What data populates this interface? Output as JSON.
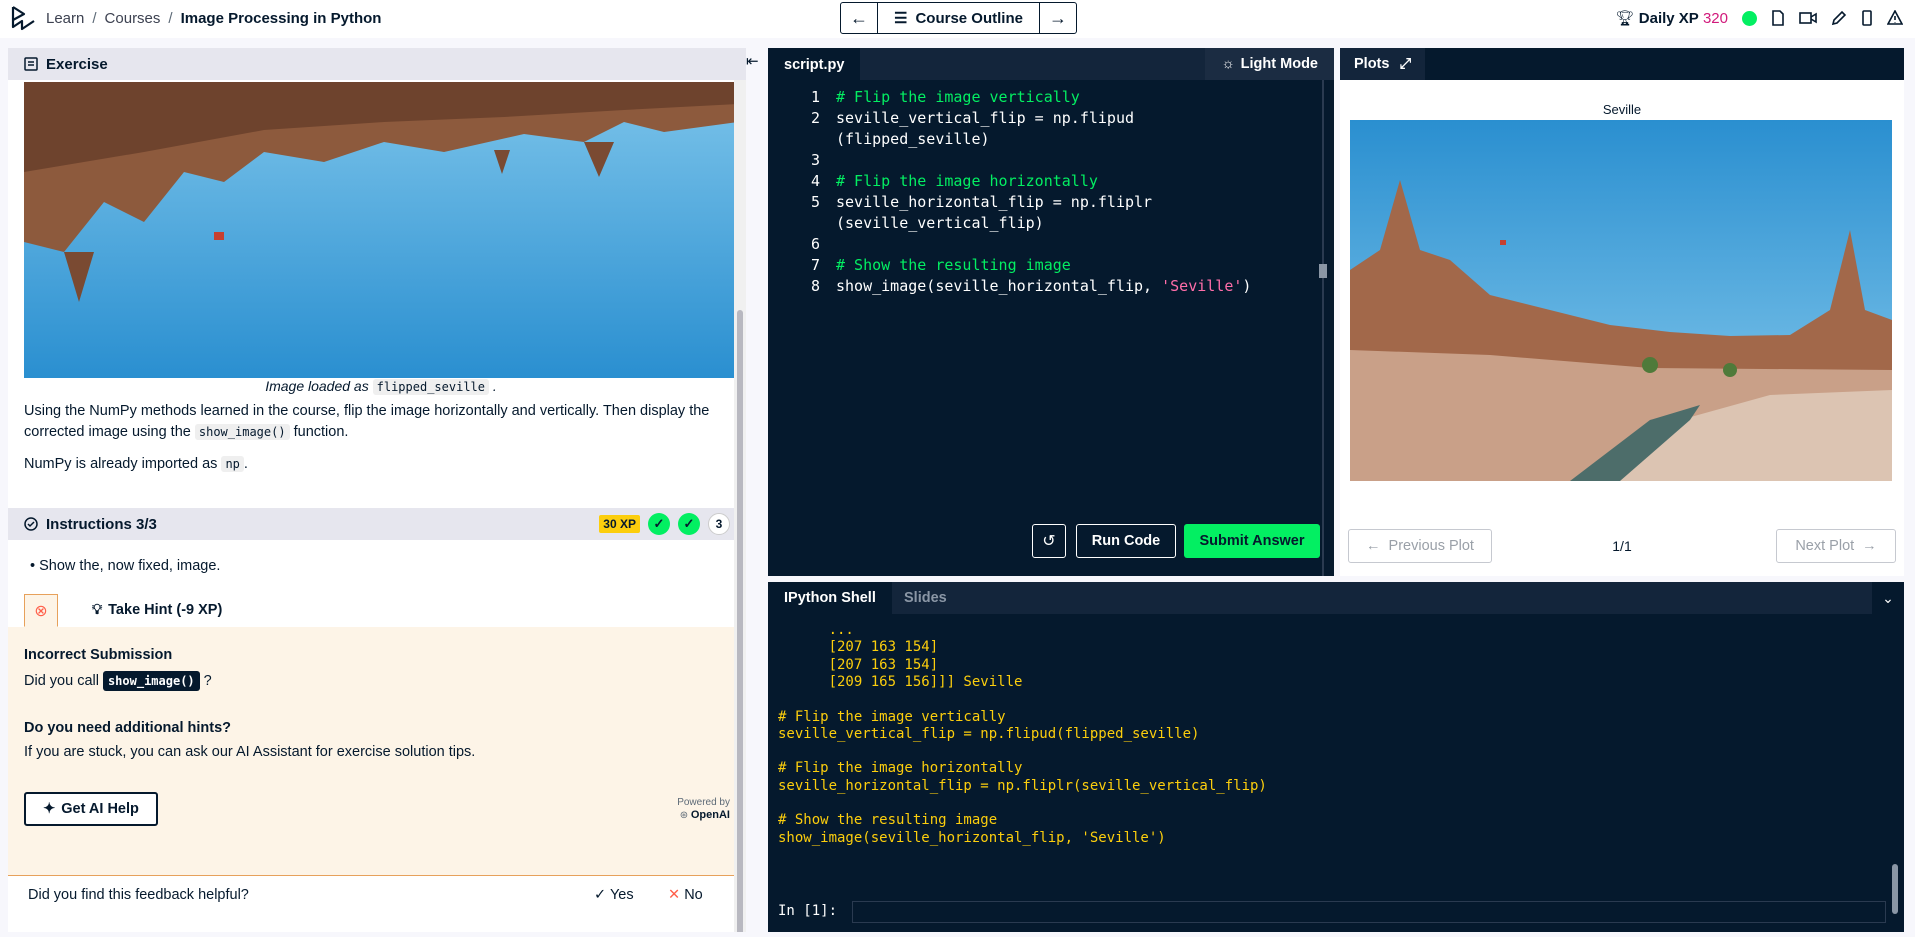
{
  "breadcrumb": {
    "learn": "Learn",
    "courses": "Courses",
    "current": "Image Processing in Python"
  },
  "course_nav": {
    "label": "Course Outline"
  },
  "topbar": {
    "xp_label": "Daily XP",
    "xp_value": "320"
  },
  "exercise": {
    "header": "Exercise",
    "caption_prefix": "Image loaded as",
    "caption_code": "flipped_seville",
    "caption_suffix": ".",
    "para1_a": "Using the NumPy methods learned in the course, flip the image horizontally and vertically. Then display the corrected image using the",
    "para1_code": "show_image()",
    "para1_b": "function.",
    "para2_a": "NumPy is already imported as",
    "para2_code": "np",
    "para2_b": "."
  },
  "instructions": {
    "title": "Instructions 3/3",
    "xp_badge": "30 XP",
    "count": "3",
    "bullet": "Show the, now fixed, image.",
    "hint_tab": "Take Hint (-9 XP)"
  },
  "feedback": {
    "title": "Incorrect Submission",
    "question_a": "Did you call",
    "question_code": "show_image()",
    "question_b": "?",
    "need_hints": "Do you need additional hints?",
    "stuck": "If you are stuck, you can ask our AI Assistant for exercise solution tips.",
    "ai_button": "Get AI Help",
    "powered_by": "Powered by",
    "openai": "OpenAI",
    "helpful": "Did you find this feedback helpful?",
    "yes": "Yes",
    "no": "No"
  },
  "editor": {
    "tab": "script.py",
    "light_mode": "Light Mode",
    "lines": [
      {
        "n": "1",
        "code": "# Flip the image vertically"
      },
      {
        "n": "2",
        "code": "seville_vertical_flip = np.flipud"
      },
      {
        "n": "",
        "code": "(flipped_seville)"
      },
      {
        "n": "3",
        "code": ""
      },
      {
        "n": "4",
        "code": "# Flip the image horizontally"
      },
      {
        "n": "5",
        "code": "seville_horizontal_flip = np.fliplr"
      },
      {
        "n": "",
        "code": "(seville_vertical_flip)"
      },
      {
        "n": "6",
        "code": ""
      },
      {
        "n": "7",
        "code": "# Show the resulting image"
      },
      {
        "n": "8",
        "code": "show_image(seville_horizontal_flip, 'Seville')"
      }
    ],
    "run": "Run Code",
    "submit": "Submit Answer"
  },
  "plots": {
    "tab": "Plots",
    "title": "Seville",
    "prev": "Previous Plot",
    "count": "1/1",
    "next": "Next Plot"
  },
  "shell": {
    "tab": "IPython Shell",
    "slides": "Slides",
    "lines": [
      "      ...",
      "      [207 163 154]",
      "      [207 163 154]",
      "      [209 165 156]]] Seville",
      "",
      "# Flip the image vertically",
      "seville_vertical_flip = np.flipud(flipped_seville)",
      "",
      "# Flip the image horizontally",
      "seville_horizontal_flip = np.fliplr(seville_vertical_flip)",
      "",
      "# Show the resulting image",
      "show_image(seville_horizontal_flip, 'Seville')"
    ],
    "prompt": "In [1]:"
  },
  "colors": {
    "brand_green": "#03ef62",
    "navy": "#05192d",
    "xp_pink": "#d1197b",
    "xp_yellow": "#fcce0d"
  }
}
